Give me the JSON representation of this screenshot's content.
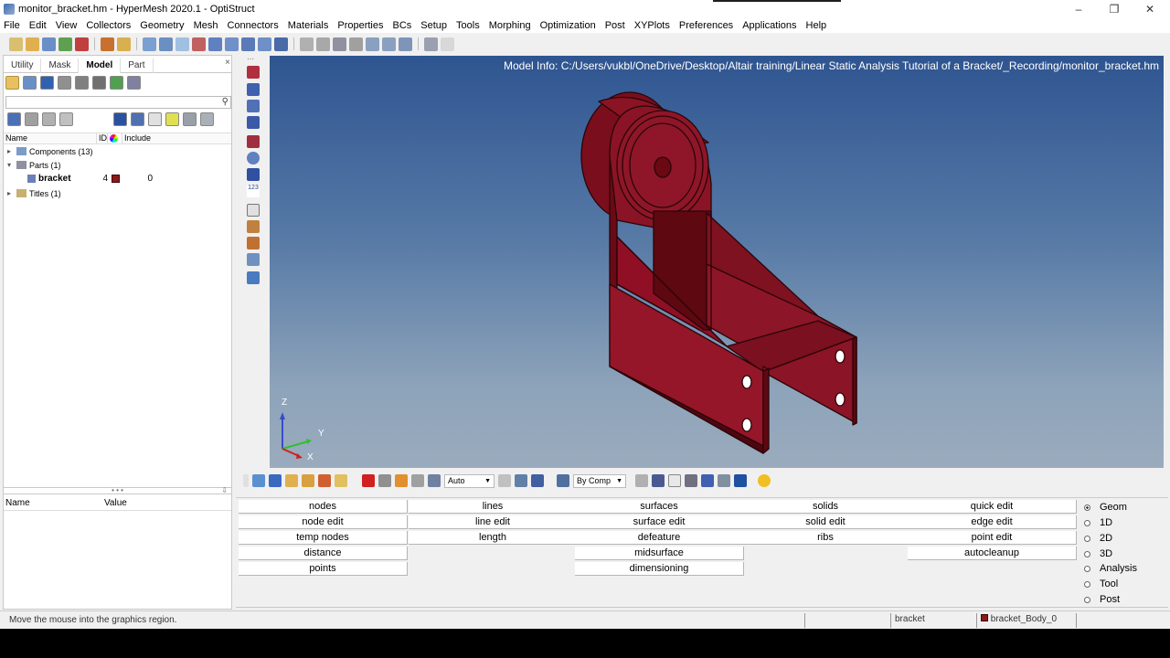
{
  "window": {
    "title": "monitor_bracket.hm - HyperMesh 2020.1 - OptiStruct",
    "controls": {
      "minimize": "–",
      "restore": "❐",
      "close": "✕"
    }
  },
  "menu": [
    "File",
    "Edit",
    "View",
    "Collectors",
    "Geometry",
    "Mesh",
    "Connectors",
    "Materials",
    "Properties",
    "BCs",
    "Setup",
    "Tools",
    "Morphing",
    "Optimization",
    "Post",
    "XYPlots",
    "Preferences",
    "Applications",
    "Help"
  ],
  "browser": {
    "tabs": [
      "Utility",
      "Mask",
      "Model",
      "Part"
    ],
    "active_tab": "Model",
    "close_glyph": "×",
    "search_glyph": "⚲",
    "columns": {
      "name": "Name",
      "id": "ID",
      "include": "Include"
    },
    "tree": {
      "components": "Components (13)",
      "parts": "Parts (1)",
      "bracket": {
        "name": "bracket",
        "id": "4",
        "include": "0"
      },
      "titles": "Titles (1)"
    },
    "splitter_glyph": "• • •",
    "splitter_arrow": "⇩",
    "properties": {
      "name": "Name",
      "value": "Value"
    },
    "accent_color": "#8b1a1a"
  },
  "graphics": {
    "model_info": "Model Info: C:/Users/vukbl/OneDrive/Desktop/Altair training/Linear Static Analysis Tutorial of a Bracket/_Recording/monitor_bracket.hm",
    "axes": {
      "z": "Z",
      "y": "Y",
      "x": "X"
    },
    "model_color": "#8b1a2a"
  },
  "bottom_toolbar": {
    "auto_label": "Auto",
    "bycomp_label": "By Comp",
    "dropdown_glyph": "▼"
  },
  "main_menu": {
    "col1": [
      "nodes",
      "node edit",
      "temp nodes",
      "distance",
      "points"
    ],
    "col2": [
      "lines",
      "line edit",
      "length"
    ],
    "col3": [
      "surfaces",
      "surface edit",
      "defeature",
      "midsurface",
      "dimensioning"
    ],
    "col4": [
      "solids",
      "solid edit",
      "ribs"
    ],
    "col5": [
      "quick edit",
      "edge edit",
      "point edit",
      "autocleanup"
    ],
    "pages": [
      "Geom",
      "1D",
      "2D",
      "3D",
      "Analysis",
      "Tool",
      "Post"
    ],
    "active_page": "Geom"
  },
  "status": {
    "message": "Move the mouse into the graphics region.",
    "component": "bracket",
    "body": "bracket_Body_0"
  }
}
